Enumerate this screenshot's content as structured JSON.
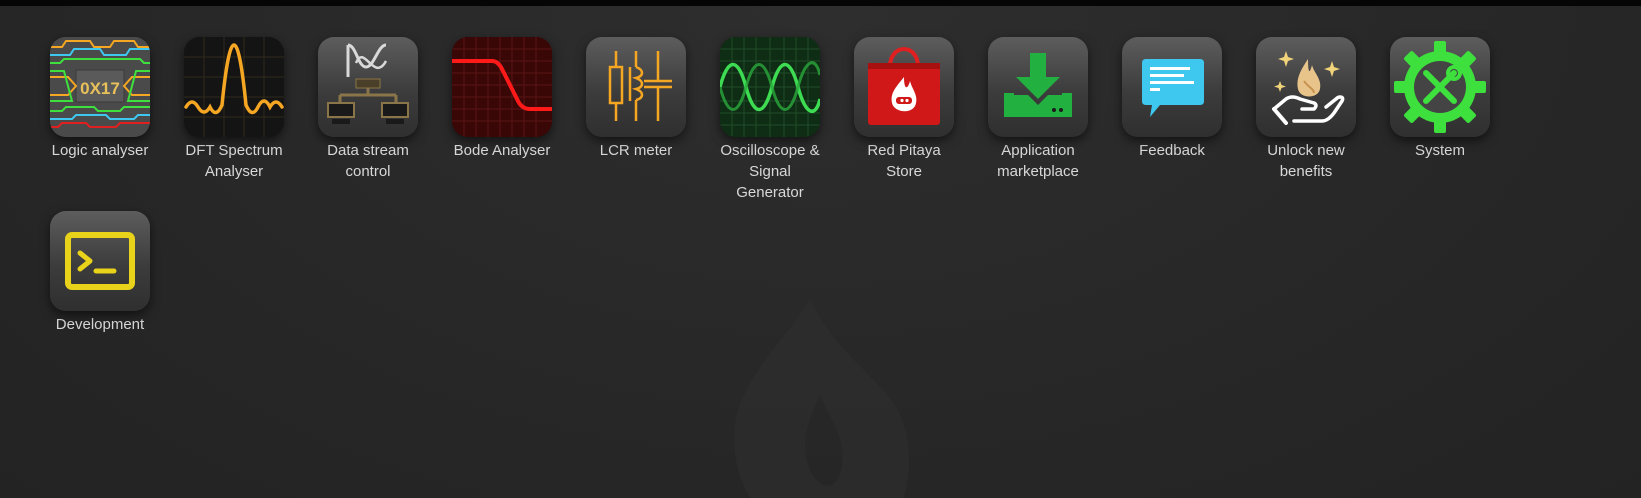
{
  "apps": [
    {
      "label": "Logic analyser",
      "icon": "logic-analyser-icon"
    },
    {
      "label": "DFT Spectrum\nAnalyser",
      "icon": "dft-spectrum-icon"
    },
    {
      "label": "Data stream\ncontrol",
      "icon": "data-stream-icon"
    },
    {
      "label": "Bode Analyser",
      "icon": "bode-analyser-icon"
    },
    {
      "label": "LCR meter",
      "icon": "lcr-meter-icon"
    },
    {
      "label": "Oscilloscope &\nSignal\nGenerator",
      "icon": "oscilloscope-icon"
    },
    {
      "label": "Red Pitaya\nStore",
      "icon": "store-bag-icon"
    },
    {
      "label": "Application\nmarketplace",
      "icon": "download-icon"
    },
    {
      "label": "Feedback",
      "icon": "chat-bubble-icon"
    },
    {
      "label": "Unlock new\nbenefits",
      "icon": "hand-sparkle-icon"
    },
    {
      "label": "System",
      "icon": "gear-wrench-icon"
    },
    {
      "label": "Development",
      "icon": "terminal-icon"
    }
  ],
  "logo_text": "0X17",
  "colors": {
    "background": "#262626",
    "label": "#d8d8d8",
    "accent_orange": "#f5a623",
    "accent_green": "#3de03d",
    "accent_red": "#e02020",
    "accent_cyan": "#3ec8f0",
    "accent_yellow": "#e8d21a"
  }
}
